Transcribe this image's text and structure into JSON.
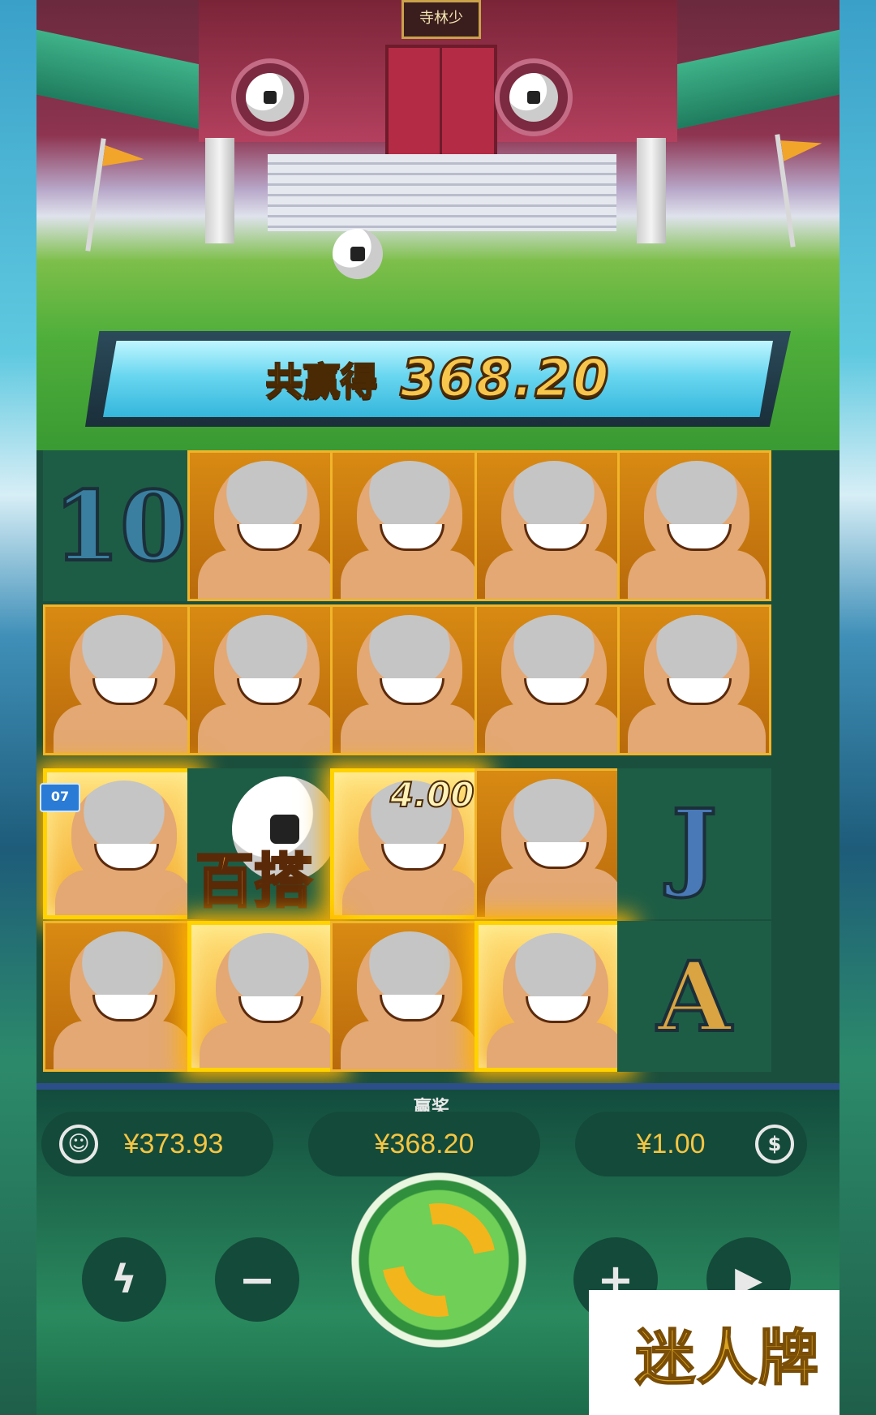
{
  "scene": {
    "plaque": "寺林少"
  },
  "win_banner": {
    "label": "共赢得",
    "value": "368.20"
  },
  "reels": {
    "rows": [
      [
        "10",
        "monk",
        "monk",
        "monk",
        "monk"
      ],
      [
        "monk",
        "monk",
        "monk",
        "monk",
        "monk"
      ],
      [
        "monk-win",
        "scatter",
        "monk-win",
        "monk",
        "J"
      ],
      [
        "monk",
        "monk-win",
        "monk",
        "monk-win",
        "A"
      ]
    ],
    "scatter_label": "百搭",
    "multiplier": "4.00",
    "badge": "07"
  },
  "panel": {
    "balance": "¥373.93",
    "win_caption": "赢奖",
    "win": "¥368.20",
    "bet": "¥1.00",
    "minus": "−",
    "plus": "+"
  },
  "watermark": "迷人牌",
  "colors": {
    "gold": "#f4c542",
    "panel": "#144a3a",
    "highlight": "#ffd200"
  }
}
